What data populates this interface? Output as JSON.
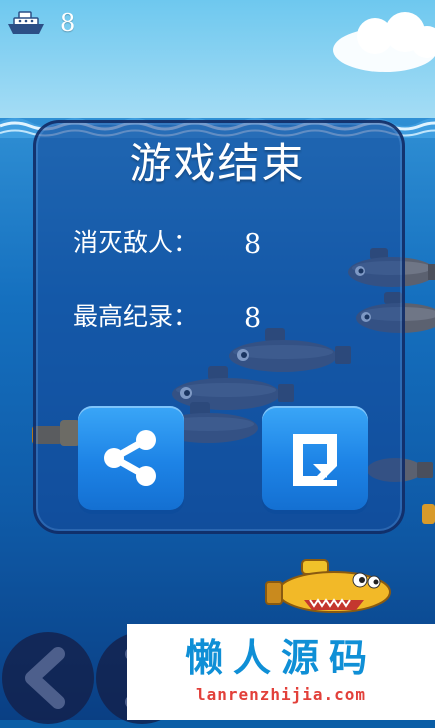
{
  "hud": {
    "ship_icon": "ship-icon",
    "score": "8"
  },
  "panel": {
    "title": "游戏结束",
    "stats": [
      {
        "label": "消灭敌人：",
        "value": "8"
      },
      {
        "label": "最高纪录：",
        "value": "8"
      }
    ],
    "buttons": [
      {
        "icon": "share-icon"
      },
      {
        "icon": "restart-icon"
      }
    ]
  },
  "controls": [
    {
      "icon": "arrow-left-icon"
    },
    {
      "icon": "arrow-right-icon"
    }
  ],
  "watermark": {
    "chinese": "懒人源码",
    "domain": "lanrenzhijia.com"
  },
  "colors": {
    "sea": "#1570bf",
    "panel_border": "#122c64",
    "button": "#1d83e6",
    "watermark_blue": "#0f8fd6",
    "watermark_red": "#e2403a"
  }
}
